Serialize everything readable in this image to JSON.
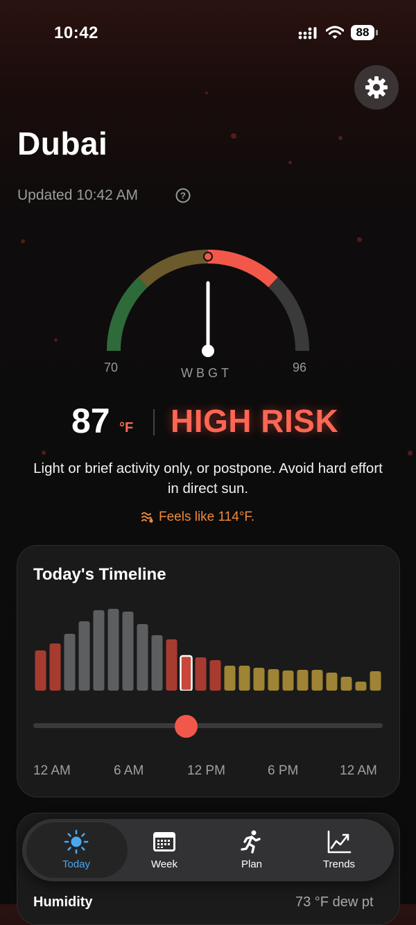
{
  "status": {
    "time": "10:42",
    "battery": "88"
  },
  "location": {
    "city": "Dubai",
    "updated": "Updated 10:42 AM"
  },
  "gauge": {
    "label": "WBGT",
    "min": "70",
    "max": "96",
    "value_fraction": 0.5,
    "colors": {
      "safe": "#2f6a3a",
      "caution": "#6b5a2c",
      "high": "#f2584a",
      "extreme": "#3a3a3a"
    }
  },
  "reading": {
    "value": "87",
    "unit": "°F",
    "risk": "HIGH RISK",
    "advice": "Light or brief activity only, or postpone. Avoid hard effort in direct sun.",
    "feels_like": "Feels like 114°F."
  },
  "timeline": {
    "title": "Today's Timeline",
    "time_labels": [
      "12 AM",
      "6 AM",
      "12 PM",
      "6 PM",
      "12 AM"
    ],
    "slider_fraction": 0.43,
    "selected_index": 10,
    "bars": [
      {
        "v": 58,
        "c": "red"
      },
      {
        "v": 68,
        "c": "red"
      },
      {
        "v": 82,
        "c": "gray"
      },
      {
        "v": 100,
        "c": "gray"
      },
      {
        "v": 116,
        "c": "gray"
      },
      {
        "v": 118,
        "c": "gray"
      },
      {
        "v": 114,
        "c": "gray"
      },
      {
        "v": 96,
        "c": "gray"
      },
      {
        "v": 80,
        "c": "gray"
      },
      {
        "v": 74,
        "c": "red"
      },
      {
        "v": 50,
        "c": "red"
      },
      {
        "v": 48,
        "c": "red"
      },
      {
        "v": 44,
        "c": "red"
      },
      {
        "v": 36,
        "c": "gold"
      },
      {
        "v": 36,
        "c": "gold"
      },
      {
        "v": 33,
        "c": "gold"
      },
      {
        "v": 31,
        "c": "gold"
      },
      {
        "v": 29,
        "c": "gold"
      },
      {
        "v": 30,
        "c": "gold"
      },
      {
        "v": 30,
        "c": "gold"
      },
      {
        "v": 26,
        "c": "gold"
      },
      {
        "v": 20,
        "c": "gold"
      },
      {
        "v": 13,
        "c": "gold"
      },
      {
        "v": 28,
        "c": "gold"
      }
    ],
    "bar_colors": {
      "red": "#a83b30",
      "gray": "#5c5e60",
      "gold": "#9e8434",
      "selected": "#c8463a"
    }
  },
  "details": {
    "humidity_label": "Humidity",
    "dew_point": "73 °F dew pt"
  },
  "tabs": [
    {
      "label": "Today",
      "icon": "sun-icon",
      "active": true
    },
    {
      "label": "Week",
      "icon": "calendar-icon",
      "active": false
    },
    {
      "label": "Plan",
      "icon": "runner-icon",
      "active": false
    },
    {
      "label": "Trends",
      "icon": "trend-chart-icon",
      "active": false
    }
  ],
  "colors": {
    "accent": "#f2584a",
    "feels": "#f08a3a",
    "tab_active": "#4aa8f0"
  }
}
